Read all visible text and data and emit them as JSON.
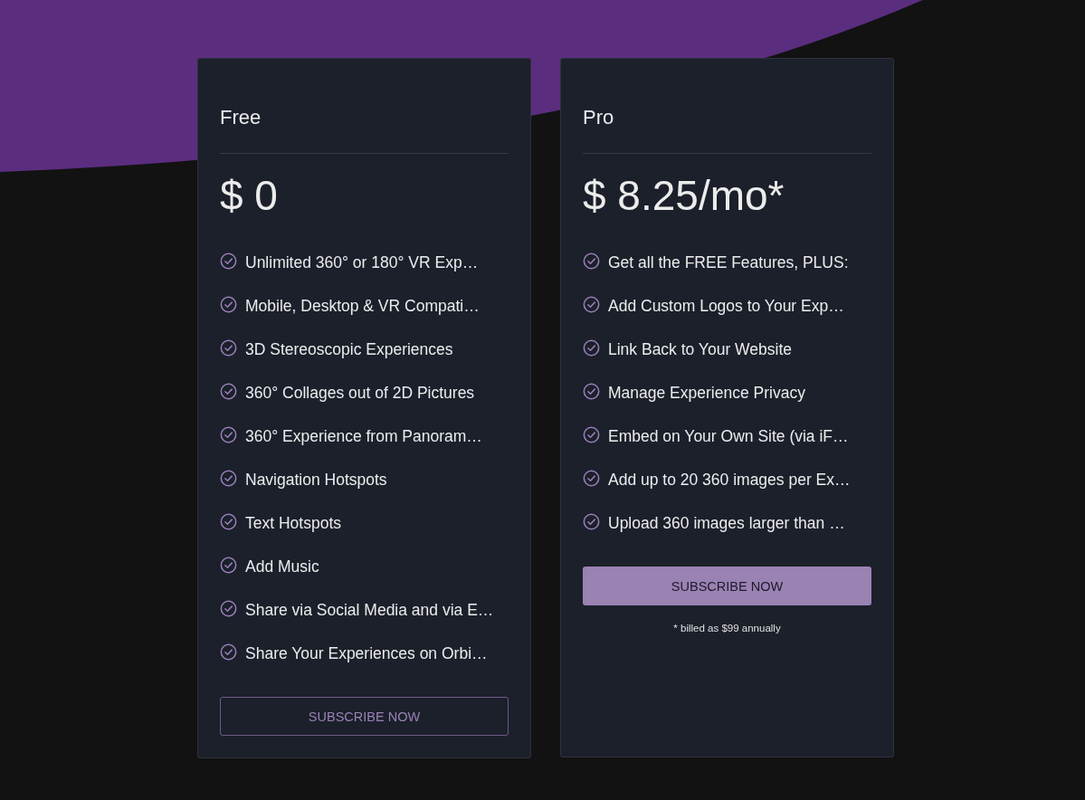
{
  "plans": [
    {
      "name": "Free",
      "price": "$ 0",
      "features": [
        "Unlimited 360° or 180° VR Exp…",
        "Mobile, Desktop & VR Compati…",
        "3D Stereoscopic Experiences",
        "360° Collages out of 2D Pictures",
        "360° Experience from Panoram…",
        "Navigation Hotspots",
        "Text Hotspots",
        "Add Music",
        "Share via Social Media and via E…",
        "Share Your Experiences on Orbi…"
      ],
      "button": {
        "label": "SUBSCRIBE NOW",
        "kind": "outline"
      }
    },
    {
      "name": "Pro",
      "price": "$ 8.25/mo*",
      "features": [
        "Get all the FREE Features, PLUS:",
        "Add Custom Logos to Your Exp…",
        "Link Back to Your Website",
        "Manage Experience Privacy",
        "Embed on Your Own Site (via iF…",
        "Add up to 20 360 images per Ex…",
        "Upload 360 images larger than …"
      ],
      "button": {
        "label": "SUBSCRIBE NOW",
        "kind": "filled"
      },
      "note": "* billed as $99 annually"
    }
  ]
}
